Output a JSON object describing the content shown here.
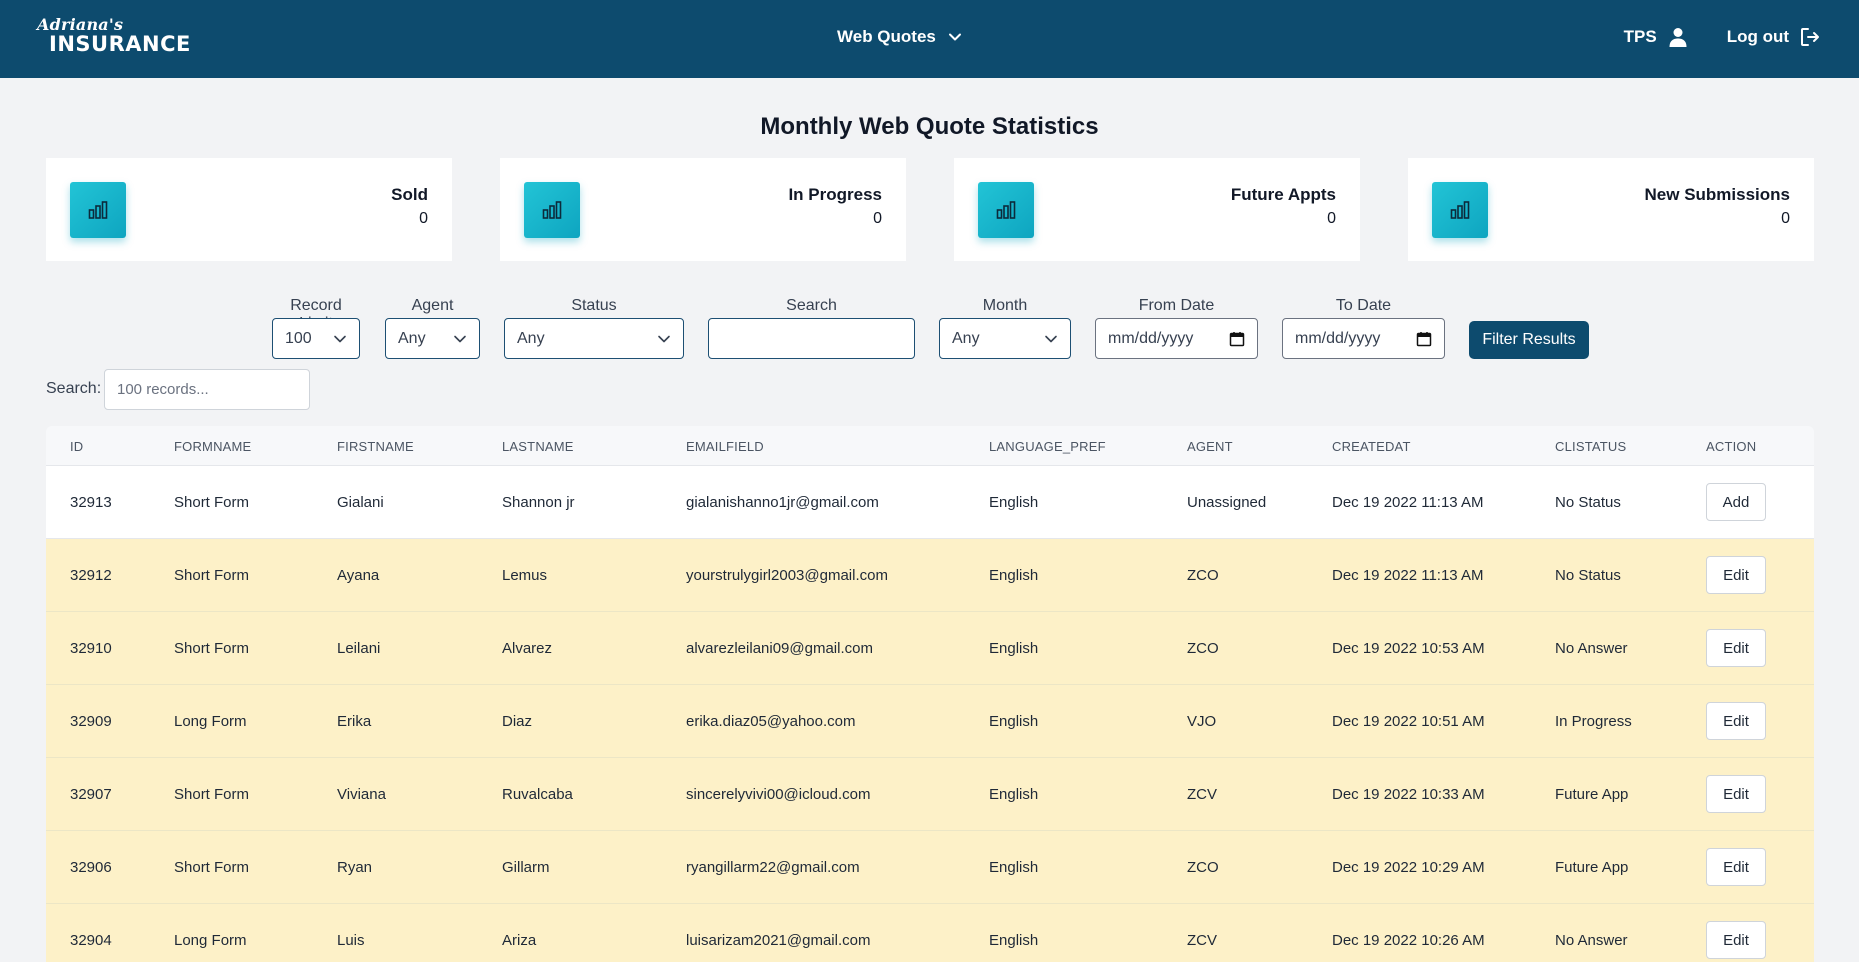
{
  "header": {
    "logo_script": "Adriana's",
    "logo_word": "INSURANCE",
    "nav_label": "Web Quotes",
    "user_label": "TPS",
    "logout_label": "Log out"
  },
  "page_title": "Monthly Web Quote Statistics",
  "stats": [
    {
      "label": "Sold",
      "value": "0"
    },
    {
      "label": "In Progress",
      "value": "0"
    },
    {
      "label": "Future Appts",
      "value": "0"
    },
    {
      "label": "New Submissions",
      "value": "0"
    }
  ],
  "filters": {
    "record_limit": {
      "label": "Record Limit",
      "value": "100"
    },
    "agent": {
      "label": "Agent",
      "value": "Any"
    },
    "status": {
      "label": "Status",
      "value": "Any"
    },
    "search": {
      "label": "Search",
      "value": ""
    },
    "month": {
      "label": "Month",
      "value": "Any"
    },
    "from_date": {
      "label": "From Date",
      "placeholder": "mm/dd/yyyy"
    },
    "to_date": {
      "label": "To Date",
      "placeholder": "mm/dd/yyyy"
    },
    "button": "Filter Results"
  },
  "table_search": {
    "label": "Search:",
    "placeholder": "100 records..."
  },
  "table": {
    "columns": [
      "ID",
      "FORMNAME",
      "FIRSTNAME",
      "LASTNAME",
      "EMAILFIELD",
      "LANGUAGE_PREF",
      "AGENT",
      "CREATEDAT",
      "CLISTATUS",
      "ACTION"
    ],
    "rows": [
      {
        "id": "32913",
        "form": "Short Form",
        "first": "Gialani",
        "last": "Shannon jr",
        "email": "gialanishanno1jr@gmail.com",
        "lang": "English",
        "agent": "Unassigned",
        "created": "Dec 19 2022 11:13 AM",
        "status": "No Status",
        "action": "Add"
      },
      {
        "id": "32912",
        "form": "Short Form",
        "first": "Ayana",
        "last": "Lemus",
        "email": "yourstrulygirl2003@gmail.com",
        "lang": "English",
        "agent": "ZCO",
        "created": "Dec 19 2022 11:13 AM",
        "status": "No Status",
        "action": "Edit"
      },
      {
        "id": "32910",
        "form": "Short Form",
        "first": "Leilani",
        "last": "Alvarez",
        "email": "alvarezleilani09@gmail.com",
        "lang": "English",
        "agent": "ZCO",
        "created": "Dec 19 2022 10:53 AM",
        "status": "No Answer",
        "action": "Edit"
      },
      {
        "id": "32909",
        "form": "Long Form",
        "first": "Erika",
        "last": "Diaz",
        "email": "erika.diaz05@yahoo.com",
        "lang": "English",
        "agent": "VJO",
        "created": "Dec 19 2022 10:51 AM",
        "status": "In Progress",
        "action": "Edit"
      },
      {
        "id": "32907",
        "form": "Short Form",
        "first": "Viviana",
        "last": "Ruvalcaba",
        "email": "sincerelyvivi00@icloud.com",
        "lang": "English",
        "agent": "ZCV",
        "created": "Dec 19 2022 10:33 AM",
        "status": "Future App",
        "action": "Edit"
      },
      {
        "id": "32906",
        "form": "Short Form",
        "first": "Ryan",
        "last": "Gillarm",
        "email": "ryangillarm22@gmail.com",
        "lang": "English",
        "agent": "ZCO",
        "created": "Dec 19 2022 10:29 AM",
        "status": "Future App",
        "action": "Edit"
      },
      {
        "id": "32904",
        "form": "Long Form",
        "first": "Luis",
        "last": "Ariza",
        "email": "luisarizam2021@gmail.com",
        "lang": "English",
        "agent": "ZCV",
        "created": "Dec 19 2022 10:26 AM",
        "status": "No Answer",
        "action": "Edit"
      }
    ]
  },
  "colors": {
    "header_bg": "#0d4b6e",
    "accent_icon": "#22c4d6",
    "row_highlight": "#fdf1c8"
  }
}
